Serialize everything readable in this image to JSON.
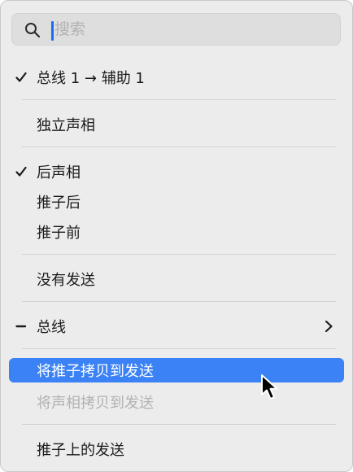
{
  "search": {
    "placeholder": "搜索",
    "value": ""
  },
  "items": {
    "bus_aux": {
      "label": "总线 1 → 辅助 1",
      "checked": true
    },
    "solo_pan": {
      "label": "独立声相"
    },
    "post_pan": {
      "label": "后声相",
      "checked": true
    },
    "post_fader": {
      "label": "推子后"
    },
    "pre_fader": {
      "label": "推子前"
    },
    "no_send": {
      "label": "没有发送"
    },
    "bus": {
      "label": "总线",
      "mixed": true,
      "has_submenu": true
    },
    "copy_fader": {
      "label": "将推子拷贝到发送",
      "selected": true
    },
    "copy_pan": {
      "label": "将声相拷贝到发送",
      "disabled": true
    },
    "sends_on_fader": {
      "label": "推子上的发送"
    }
  },
  "colors": {
    "selection": "#3b82f6",
    "caret": "#1a6cf0",
    "disabled_text": "#b2b2b2",
    "menu_background": "#ececec"
  }
}
